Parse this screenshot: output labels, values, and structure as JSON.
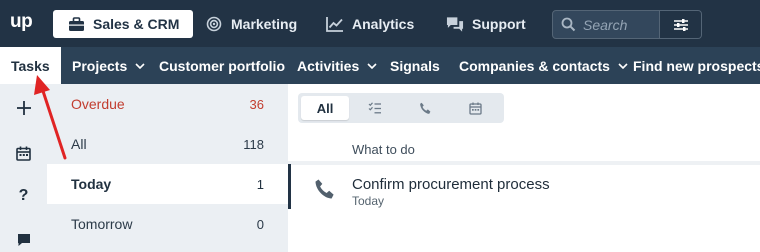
{
  "app": {
    "logo": "up"
  },
  "top_nav": {
    "items": [
      {
        "label": "Sales & CRM",
        "icon": "briefcase-icon",
        "active": true
      },
      {
        "label": "Marketing",
        "icon": "target-icon",
        "active": false
      },
      {
        "label": "Analytics",
        "icon": "chart-line-icon",
        "active": false
      },
      {
        "label": "Support",
        "icon": "chat-bubbles-icon",
        "active": false
      }
    ],
    "search": {
      "placeholder": "Search",
      "icon": "search-icon",
      "filter_icon": "sliders-icon"
    }
  },
  "sub_nav": {
    "items": [
      {
        "label": "Tasks",
        "active": true,
        "has_dropdown": false
      },
      {
        "label": "Projects",
        "active": false,
        "has_dropdown": true
      },
      {
        "label": "Customer portfolio",
        "active": false,
        "has_dropdown": false
      },
      {
        "label": "Activities",
        "active": false,
        "has_dropdown": true
      },
      {
        "label": "Signals",
        "active": false,
        "has_dropdown": false
      },
      {
        "label": "Companies & contacts",
        "active": false,
        "has_dropdown": true
      },
      {
        "label": "Find new prospects",
        "active": false,
        "has_dropdown": false
      }
    ]
  },
  "rail": {
    "icons": [
      "plus-icon",
      "calendar-icon",
      "help-icon",
      "chat-icon"
    ]
  },
  "task_filters": [
    {
      "label": "Overdue",
      "count": "36",
      "style": "overdue"
    },
    {
      "label": "All",
      "count": "118",
      "style": "normal"
    },
    {
      "label": "Today",
      "count": "1",
      "style": "selected"
    },
    {
      "label": "Tomorrow",
      "count": "0",
      "style": "normal"
    }
  ],
  "type_filter": {
    "all_label": "All",
    "icons": [
      "checklist-icon",
      "phone-icon",
      "calendar-icon"
    ]
  },
  "task_list": {
    "column_header": "What to do",
    "tasks": [
      {
        "title": "Confirm procurement process",
        "due": "Today",
        "icon": "phone-icon"
      }
    ]
  },
  "colors": {
    "topbar": "#223345",
    "subbar": "#2c4257",
    "overdue": "#c23d2f",
    "annotation_arrow": "#e02424"
  }
}
